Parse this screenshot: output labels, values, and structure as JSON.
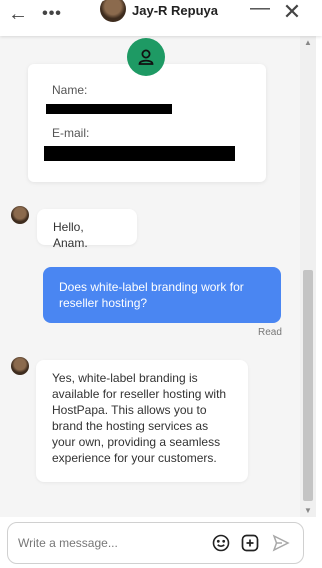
{
  "header": {
    "back_icon": "←",
    "more_icon": "•••",
    "agent_name": "Jay-R Repuya",
    "minimize_icon": "—",
    "close_icon": "✕"
  },
  "contact_card": {
    "name_label": "Name:",
    "email_label": "E-mail:"
  },
  "messages": [
    {
      "from": "agent",
      "text": "Hello, Anam."
    },
    {
      "from": "user",
      "text": "Does white-label branding work for reseller hosting?"
    },
    {
      "from": "agent",
      "text": "Yes, white-label branding is available for reseller hosting with HostPapa. This allows you to brand the hosting services as your own, providing a seamless experience for your customers."
    }
  ],
  "read_status": "Read",
  "composer": {
    "placeholder": "Write a message..."
  },
  "colors": {
    "user_bubble": "#4a86f2",
    "profile_icon": "#1e9a64",
    "online": "#31c65a"
  }
}
